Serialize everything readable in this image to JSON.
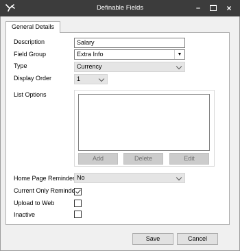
{
  "window": {
    "title": "Definable Fields",
    "icon": "app-logo-icon",
    "controls": {
      "minimize": "–",
      "close": "×"
    }
  },
  "tabs": [
    {
      "label": "General Details",
      "selected": true
    }
  ],
  "form": {
    "description": {
      "label": "Description",
      "value": "Salary"
    },
    "field_group": {
      "label": "Field Group",
      "value": "Extra Info"
    },
    "type": {
      "label": "Type",
      "value": "Currency"
    },
    "display_order": {
      "label": "Display Order",
      "value": "1"
    },
    "list_options": {
      "label": "List Options",
      "items": [],
      "buttons": {
        "add": "Add",
        "delete": "Delete",
        "edit": "Edit"
      }
    },
    "home_page_reminder": {
      "label": "Home Page Reminder",
      "value": "No"
    },
    "current_only_reminder": {
      "label": "Current Only Reminder",
      "checked": true
    },
    "upload_to_web": {
      "label": "Upload to Web",
      "checked": false
    },
    "inactive": {
      "label": "Inactive",
      "checked": false
    }
  },
  "footer": {
    "save": "Save",
    "cancel": "Cancel"
  },
  "colors": {
    "titlebar": "#3c3c3c",
    "panel": "#f0f0f0",
    "disabled_button": "#cccccc"
  }
}
